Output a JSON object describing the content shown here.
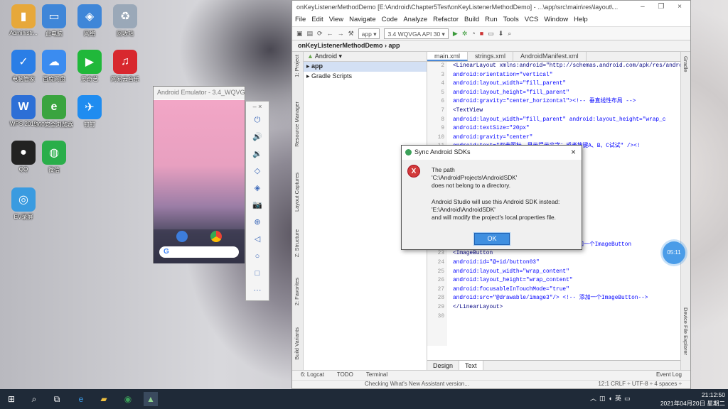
{
  "desktop": {
    "icons": [
      {
        "label": "Administr...",
        "icon": "user-folder-icon",
        "color": "#e7a83a"
      },
      {
        "label": "此电脑",
        "icon": "computer-icon",
        "color": "#3f86d8"
      },
      {
        "label": "网络",
        "icon": "network-icon",
        "color": "#3f86d8"
      },
      {
        "label": "回收站",
        "icon": "recycle-bin-icon",
        "color": "#9aa8b8"
      },
      {
        "label": "电脑管家",
        "icon": "shield-icon",
        "color": "#2a7ee6"
      },
      {
        "label": "百度网盘",
        "icon": "cloud-icon",
        "color": "#3b8cf0"
      },
      {
        "label": "爱奇艺",
        "icon": "play-icon",
        "color": "#20b83a"
      },
      {
        "label": "网易云音乐",
        "icon": "music-icon",
        "color": "#d8282e"
      },
      {
        "label": "WPS 2019",
        "icon": "wps-icon",
        "color": "#2d6fd6"
      },
      {
        "label": "360安全浏览器",
        "icon": "browser-icon",
        "color": "#3aa43f"
      },
      {
        "label": "钉钉",
        "icon": "dingtalk-icon",
        "color": "#1f8cf0"
      },
      {
        "label": "QQ",
        "icon": "qq-penguin-icon",
        "color": "#222222"
      },
      {
        "label": "微信",
        "icon": "wechat-icon",
        "color": "#2aae4a"
      },
      {
        "label": "EV录屏",
        "icon": "ev-record-icon",
        "color": "#3a9be0"
      }
    ]
  },
  "emulator": {
    "title": "Android Emulator - 3.4_WQVG...",
    "google": "G"
  },
  "emubar": {
    "top": "–  ×",
    "buttons": [
      "⏻",
      "🔊",
      "🔉",
      "◇",
      "◈",
      "📷",
      "⊕",
      "◁",
      "○",
      "□",
      "···"
    ]
  },
  "ide": {
    "title": "onKeyListenerMethodDemo [E:\\Android\\Chapter5Test\\onKeyListenerMethodDemo] - ...\\app\\src\\main\\res\\layout\\...",
    "window_controls": "–  ❐  ×",
    "menu": [
      "File",
      "Edit",
      "View",
      "Navigate",
      "Code",
      "Analyze",
      "Refactor",
      "Build",
      "Run",
      "Tools",
      "VCS",
      "Window",
      "Help"
    ],
    "toolbar": {
      "app": "app ▾",
      "device": "3.4 WQVGA API 30 ▾"
    },
    "crumbs": [
      "onKeyListenerMethodDemo",
      "app"
    ],
    "left_strip": [
      "1: Project",
      "Resource Manager",
      "Layout Captures",
      "Z: Structure",
      "2: Favorites",
      "Build Variants"
    ],
    "right_strip": [
      "Gradle",
      "Device File Explorer"
    ],
    "project": {
      "header": "Android ▾",
      "rows": [
        "▸ app",
        "▸ Gradle Scripts"
      ]
    },
    "tabs": [
      "main.xml",
      "strings.xml",
      "AndroidManifest.xml"
    ],
    "bottom_tabs": [
      "Design",
      "Text"
    ],
    "status": {
      "tools": [
        "6: Logcat",
        "TODO",
        "Terminal"
      ],
      "event_log": "Event Log",
      "message": "Checking What's New Assistant version...",
      "position": "12:1  CRLF ÷  UTF-8 ÷  4 spaces ÷"
    }
  },
  "code": {
    "line_numbers": [
      "2",
      "3",
      "4",
      "5",
      "6",
      "7",
      "8",
      "9",
      "10",
      "11",
      "12",
      "13",
      "14",
      "15",
      "16",
      "17",
      "18",
      "19",
      "20",
      "21",
      "22",
      "23",
      "24",
      "25",
      "26",
      "27",
      "28",
      "29",
      "30"
    ],
    "lines": [
      "<LinearLayout xmlns:android=\"http://schemas.android.com/apk/res/android\"",
      "    android:orientation=\"vertical\"",
      "    android:layout_width=\"fill_parent\"",
      "    android:layout_height=\"fill_parent\"",
      "    android:gravity=\"center_horizontal\"><!-- 垂直线性布局 -->",
      "    <TextView",
      "        android:layout_width=\"fill_parent\"   android:layout_height=\"wrap_c",
      "        android:textSize=\"20px\"",
      "        android:gravity=\"center\"",
      "        android:text=\"双击图标，显示提示文字；或者按键A、B、C试试\" /><!",
      "",
      "",
      "",
      "",
      "                                                    <!-- 添加一个ImageButton-->",
      "",
      "",
      "",
      "",
      "",
      "        android:src=\"@drawable/image2\"    <!-- 添加一个ImageButton",
      "    <ImageButton",
      "        android:id=\"@+id/button03\"",
      "        android:layout_width=\"wrap_content\"",
      "        android:layout_height=\"wrap_content\"",
      "        android:focusableInTouchMode=\"true\"",
      "        android:src=\"@drawable/image3\"/>    <!-- 添加一个ImageButton-->",
      "</LinearLayout>",
      ""
    ]
  },
  "dialog": {
    "title": "Sync Android SDKs",
    "close": "×",
    "error_glyph": "X",
    "message": "The path\n'C:\\AndroidProjects\\AndroidSDK'\ndoes not belong to a directory.\n\nAndroid Studio will use this Android SDK instead:\n'E:\\Android\\AndroidSDK'\nand will modify the project's local.properties file.",
    "ok": "OK"
  },
  "clock_bubble": "05:11",
  "taskbar": {
    "time": "21:12:50",
    "date": "2021年04月20日 星期二",
    "ime": "英"
  }
}
